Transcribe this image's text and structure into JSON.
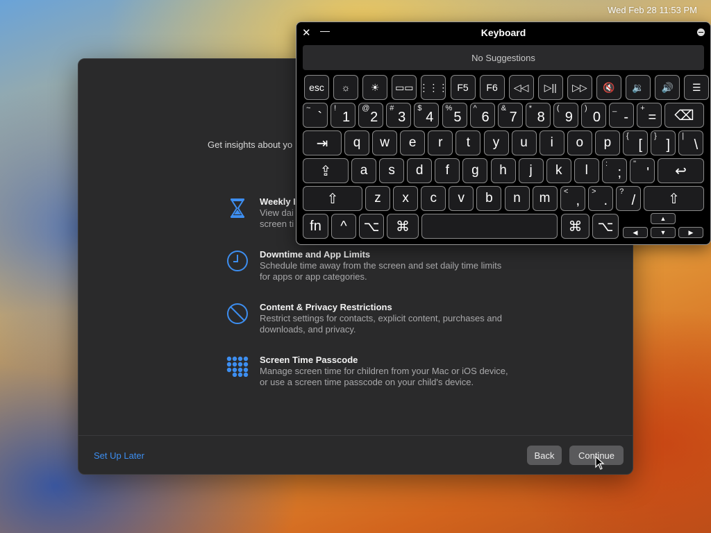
{
  "menubar": {
    "clock": "Wed Feb 28 11:53 PM"
  },
  "setup": {
    "subtitle": "Get insights about yo",
    "features": [
      {
        "title": "Weekly I",
        "desc": "View dai\nscreen ti",
        "icon": "hourglass-icon"
      },
      {
        "title": "Downtime and App Limits",
        "desc": "Schedule time away from the screen and set daily time limits for apps or app categories.",
        "icon": "clock-icon"
      },
      {
        "title": "Content & Privacy Restrictions",
        "desc": "Restrict settings for contacts, explicit content, purchases and downloads, and privacy.",
        "icon": "prohibited-icon"
      },
      {
        "title": "Screen Time Passcode",
        "desc": "Manage screen time for children from your Mac or iOS device, or use a screen time passcode on your child's device.",
        "icon": "dot-grid-icon"
      }
    ],
    "set_up_later": "Set Up Later",
    "back": "Back",
    "continue": "Continue",
    "accent": "#3d8ef0"
  },
  "keyboard": {
    "title": "Keyboard",
    "suggestions": "No Suggestions",
    "close": "✕",
    "minimize": "—",
    "fn_row": [
      {
        "label": "esc",
        "name": "key-esc"
      },
      {
        "label": "☼",
        "name": "key-brightness-down"
      },
      {
        "label": "☀",
        "name": "key-brightness-up"
      },
      {
        "label": "▭▭",
        "name": "key-mission-control"
      },
      {
        "label": "⋮⋮⋮",
        "name": "key-launchpad"
      },
      {
        "label": "F5",
        "name": "key-f5"
      },
      {
        "label": "F6",
        "name": "key-f6"
      },
      {
        "label": "◁◁",
        "name": "key-rewind"
      },
      {
        "label": "▷||",
        "name": "key-play-pause"
      },
      {
        "label": "▷▷",
        "name": "key-fast-forward"
      },
      {
        "label": "🔇",
        "name": "key-mute"
      },
      {
        "label": "🔉",
        "name": "key-volume-down"
      },
      {
        "label": "🔊",
        "name": "key-volume-up"
      },
      {
        "label": "☰",
        "name": "key-list"
      }
    ],
    "number_row": [
      {
        "shift": "~",
        "main": "`"
      },
      {
        "shift": "!",
        "main": "1"
      },
      {
        "shift": "@",
        "main": "2"
      },
      {
        "shift": "#",
        "main": "3"
      },
      {
        "shift": "$",
        "main": "4"
      },
      {
        "shift": "%",
        "main": "5"
      },
      {
        "shift": "^",
        "main": "6"
      },
      {
        "shift": "&",
        "main": "7"
      },
      {
        "shift": "*",
        "main": "8"
      },
      {
        "shift": "(",
        "main": "9"
      },
      {
        "shift": ")",
        "main": "0"
      },
      {
        "shift": "_",
        "main": "-"
      },
      {
        "shift": "+",
        "main": "="
      }
    ],
    "delete": "⌫",
    "tab": "⇥",
    "top_row": [
      "q",
      "w",
      "e",
      "r",
      "t",
      "y",
      "u",
      "i",
      "o",
      "p"
    ],
    "top_row_extra": [
      {
        "shift": "{",
        "main": "["
      },
      {
        "shift": "}",
        "main": "]"
      },
      {
        "shift": "|",
        "main": "\\"
      }
    ],
    "caps": "⇪",
    "home_row": [
      "a",
      "s",
      "d",
      "f",
      "g",
      "h",
      "j",
      "k",
      "l"
    ],
    "home_row_extra": [
      {
        "shift": ":",
        "main": ";"
      },
      {
        "shift": "\"",
        "main": "'"
      }
    ],
    "return": "↩",
    "shift": "⇧",
    "bottom_row": [
      "z",
      "x",
      "c",
      "v",
      "b",
      "n",
      "m"
    ],
    "bottom_row_extra": [
      {
        "shift": "<",
        "main": ","
      },
      {
        "shift": ">",
        "main": "."
      },
      {
        "shift": "?",
        "main": "/"
      }
    ],
    "fn": "fn",
    "control": "^",
    "option": "⌥",
    "command": "⌘",
    "space": "",
    "arrow_up": "▲",
    "arrow_left": "◀",
    "arrow_down": "▼",
    "arrow_right": "▶"
  }
}
